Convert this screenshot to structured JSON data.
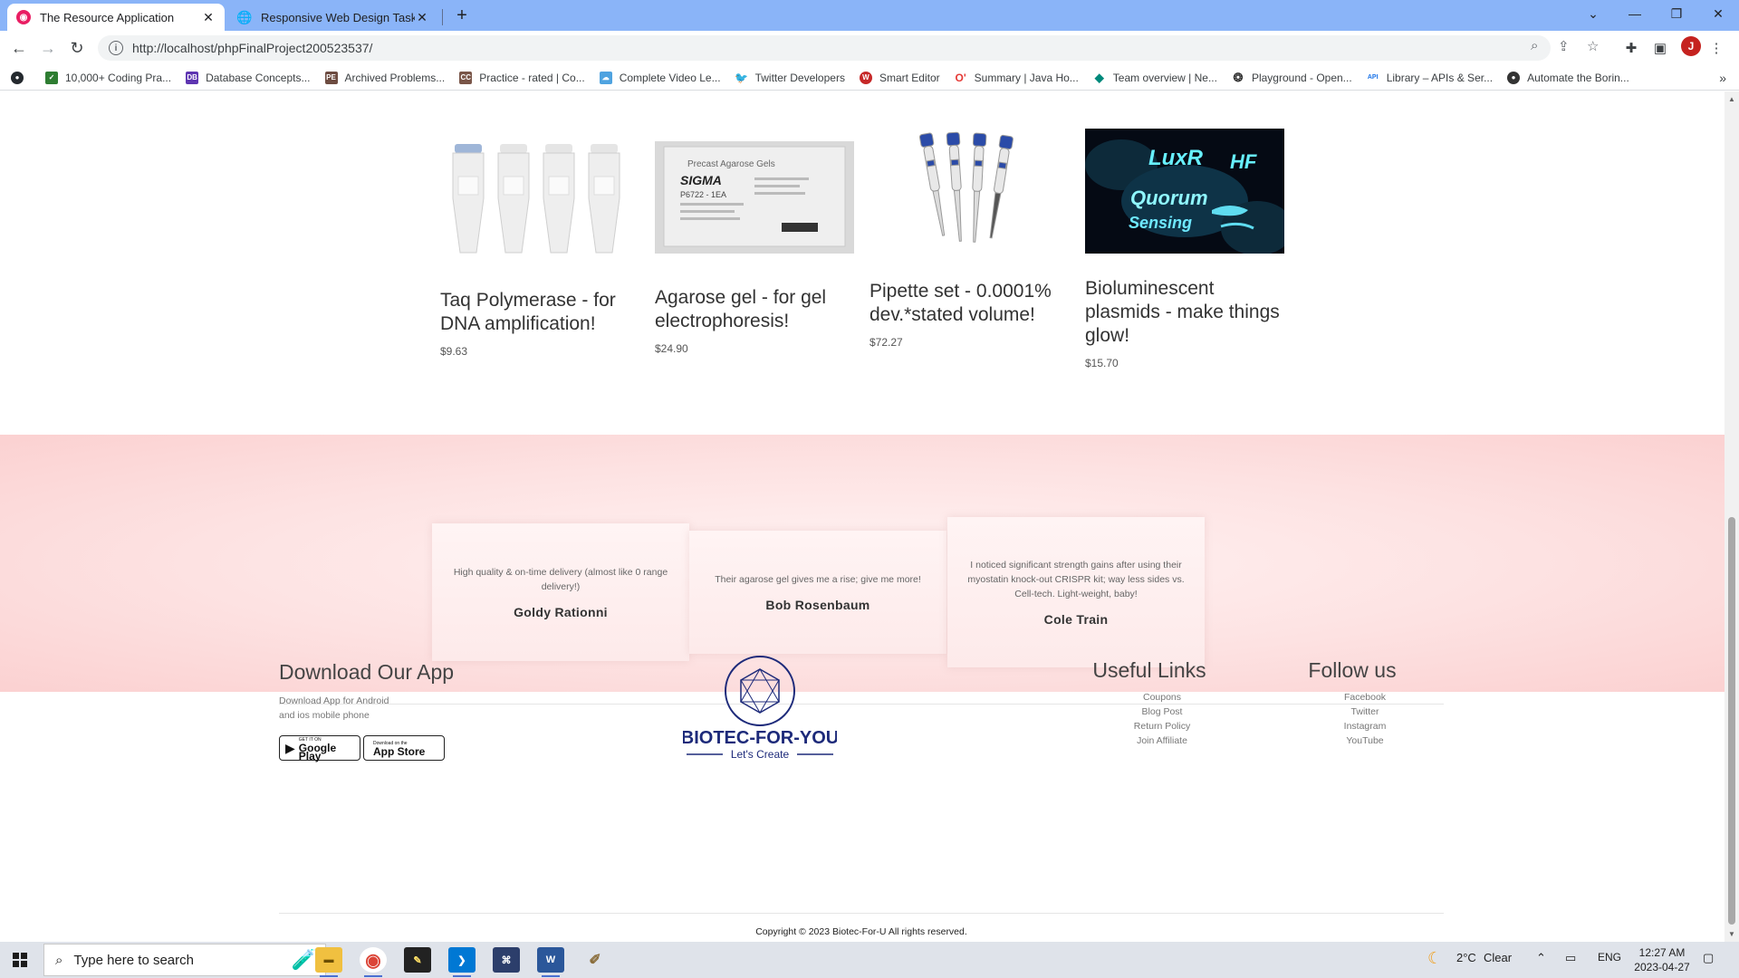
{
  "browser": {
    "tabs": [
      {
        "title": "The Resource Application",
        "active": true
      },
      {
        "title": "Responsive Web Design Task: Tas",
        "active": false
      }
    ],
    "url": "http://localhost/phpFinalProject200523537/",
    "profile_initial": "J",
    "bookmarks": [
      {
        "label": "10,000+ Coding Pra...",
        "icon": "coding-icon",
        "color": "#2e7d32"
      },
      {
        "label": "Database Concepts...",
        "icon": "db-icon",
        "color": "#5e35b1"
      },
      {
        "label": "Archived Problems...",
        "icon": "pe-icon",
        "color": "#6d4c41"
      },
      {
        "label": "Practice - rated | Co...",
        "icon": "codechef-icon",
        "color": "#795548"
      },
      {
        "label": "Complete Video Le...",
        "icon": "cloud-icon",
        "color": "#4fa3e0"
      },
      {
        "label": "Twitter Developers",
        "icon": "twitter-icon",
        "color": "#1da1f2"
      },
      {
        "label": "Smart Editor",
        "icon": "editor-icon",
        "color": "#c62828"
      },
      {
        "label": "Summary | Java Ho...",
        "icon": "java-icon",
        "color": "#e53935"
      },
      {
        "label": "Team overview | Ne...",
        "icon": "diamond-icon",
        "color": "#00897b"
      },
      {
        "label": "Playground - Open...",
        "icon": "openai-icon",
        "color": "#333333"
      },
      {
        "label": "Library – APIs & Ser...",
        "icon": "api-icon",
        "color": "#1a73e8"
      },
      {
        "label": "Automate the Borin...",
        "icon": "globe-icon",
        "color": "#333333"
      }
    ]
  },
  "products": [
    {
      "name": "Taq Polymerase - for DNA amplification!",
      "price": "$9.63",
      "image": "tubes"
    },
    {
      "name": "Agarose gel - for gel electrophoresis!",
      "price": "$24.90",
      "image": "gel-pack"
    },
    {
      "name": "Pipette set - 0.0001% dev.*stated volume!",
      "price": "$72.27",
      "image": "pipettes"
    },
    {
      "name": "Bioluminescent plasmids - make things glow!",
      "price": "$15.70",
      "image": "glow-plate"
    }
  ],
  "gel_pack_label": {
    "line1": "Precast Agarose Gels",
    "brand": "SIGMA",
    "code": "P6722 - 1EA"
  },
  "glow_text": {
    "line1": "LuxR",
    "line2": "Quorum",
    "line3": "Sensing",
    "line4": "HF"
  },
  "testimonials": [
    {
      "quote": "High quality & on-time delivery (almost like 0 range delivery!)",
      "author": "Goldy Rationni"
    },
    {
      "quote": "Their agarose gel gives me a rise; give me more!",
      "author": "Bob Rosenbaum"
    },
    {
      "quote": "I noticed significant strength gains after using their myostatin knock-out CRISPR kit; way less sides vs. Cell-tech. Light-weight, baby!",
      "author": "Cole Train"
    }
  ],
  "footer": {
    "app_title": "Download Our App",
    "app_text_1": "Download App for Android",
    "app_text_2": "and ios mobile phone",
    "google_small": "GET IT ON",
    "google_big": "Google Play",
    "apple_small": "Download on the",
    "apple_big": "App Store",
    "logo_name": "BIOTEC-FOR-YOU",
    "logo_tagline": "Let's Create",
    "useful_title": "Useful Links",
    "useful_links": [
      "Coupons",
      "Blog Post",
      "Return Policy",
      "Join Affiliate"
    ],
    "follow_title": "Follow us",
    "follow_links": [
      "Facebook",
      "Twitter",
      "Instagram",
      "YouTube"
    ],
    "copyright": "Copyright © 2023 Biotec-For-U All rights reserved."
  },
  "taskbar": {
    "search_placeholder": "Type here to search",
    "weather_temp": "2°C",
    "weather_desc": "Clear",
    "language": "ENG",
    "time": "12:27 AM",
    "date": "2023-04-27"
  }
}
